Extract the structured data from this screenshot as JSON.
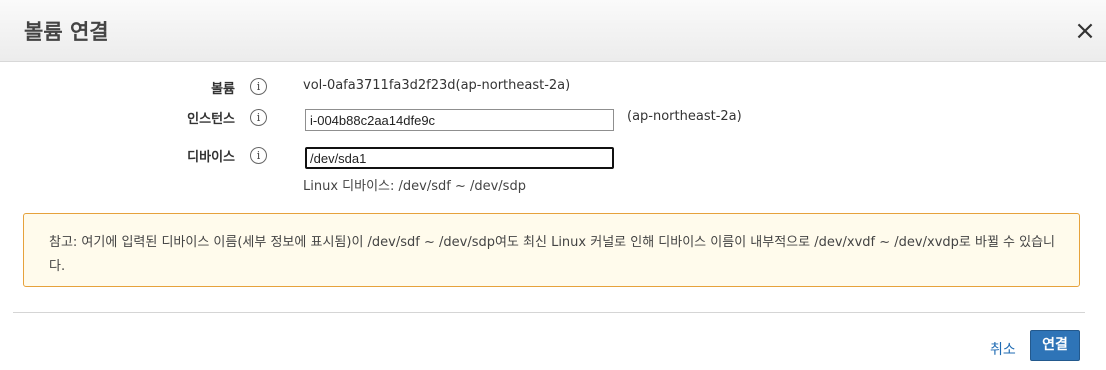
{
  "dialog": {
    "title": "볼륨 연결",
    "close_glyph": "×"
  },
  "form": {
    "volume": {
      "label": "볼륨",
      "value": "vol-0afa3711fa3d2f23d(ap-northeast-2a)"
    },
    "instance": {
      "label": "인스턴스",
      "value": "i-004b88c2aa14dfe9c",
      "region": "(ap-northeast-2a)"
    },
    "device": {
      "label": "디바이스",
      "value": "/dev/sda1",
      "hint": "Linux 디바이스: /dev/sdf ~ /dev/sdp"
    },
    "info_glyph": "i"
  },
  "note": {
    "text": "참고: 여기에 입력된 디바이스 이름(세부 정보에 표시됨)이 /dev/sdf ~ /dev/sdp여도 최신 Linux 커널로 인해 디바이스 이름이 내부적으로 /dev/xvdf ~ /dev/xvdp로 바뀔 수 있습니다."
  },
  "footer": {
    "cancel_label": "취소",
    "attach_label": "연결"
  },
  "colors": {
    "primary": "#2e74b7",
    "link": "#1f6bb3",
    "note_border": "#e6a23c",
    "note_bg": "#fffbec"
  }
}
